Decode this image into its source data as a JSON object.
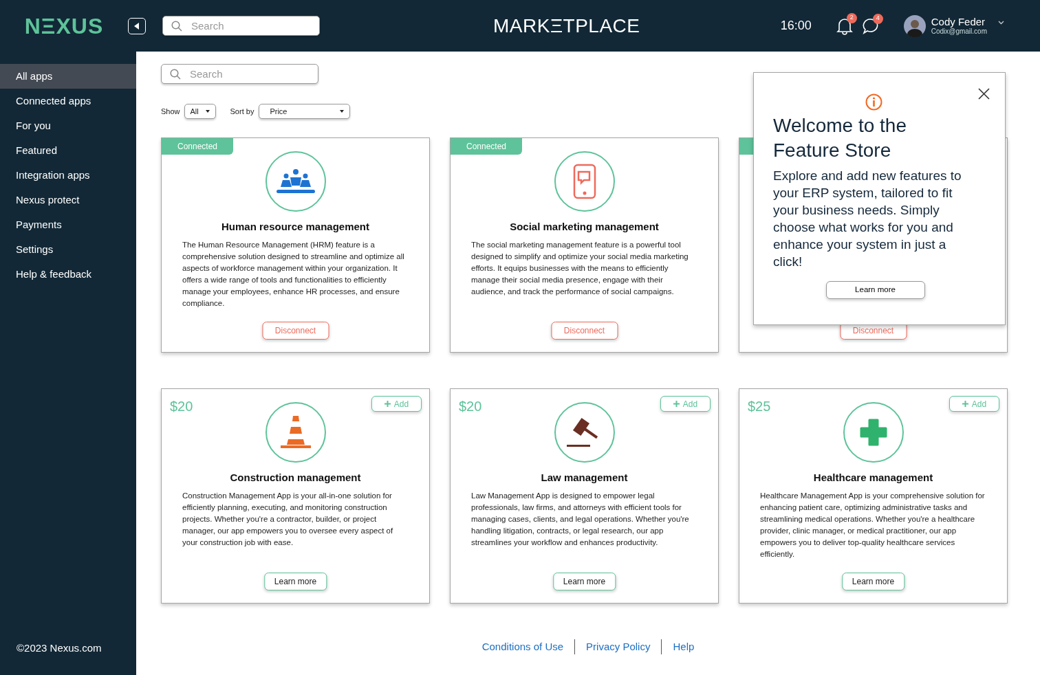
{
  "header": {
    "logo": "NΞXUS",
    "search": {
      "placeholder": "Search"
    },
    "title": "MARKΞTPLACE",
    "time": "16:00",
    "notifications": "2",
    "messages": "4",
    "user": {
      "name": "Cody Feder",
      "email": "Codix@gmail.com"
    }
  },
  "sidebar": {
    "items": [
      {
        "label": "All apps",
        "selected": true
      },
      {
        "label": "Connected apps",
        "selected": false
      },
      {
        "label": "For you",
        "selected": false
      },
      {
        "label": "Featured",
        "selected": false
      },
      {
        "label": "Integration apps",
        "selected": false
      },
      {
        "label": "Nexus protect",
        "selected": false
      },
      {
        "label": "Payments",
        "selected": false
      },
      {
        "label": "Settings",
        "selected": false
      },
      {
        "label": "Help & feedback",
        "selected": false
      }
    ],
    "copyright": "©2023 Nexus.com"
  },
  "filters": {
    "search": {
      "placeholder": "Search"
    },
    "show_label": "Show",
    "show_value": "All",
    "sort_label": "Sort by",
    "sort_value": "Price"
  },
  "cards": [
    {
      "kind": "connected",
      "tag": "Connected",
      "title": "Human resource management",
      "description": "The Human Resource Management (HRM) feature is a comprehensive solution designed to streamline and optimize all aspects of workforce management within your organization. It offers a wide range of tools and functionalities to efficiently manage your employees, enhance HR processes, and ensure compliance.",
      "button": "Disconnect"
    },
    {
      "kind": "connected",
      "tag": "Connected",
      "title": "Social marketing management",
      "description": "The social marketing management feature is a powerful tool designed to simplify and optimize your social media marketing efforts. It equips businesses with the means to efficiently manage their social media presence, engage with their audience, and track the performance of social campaigns.",
      "button": "Disconnect"
    },
    {
      "kind": "connected",
      "button": "Disconnect"
    },
    {
      "kind": "paid",
      "price": "$20",
      "add": "Add",
      "title": "Construction management",
      "description": "Construction Management App is your all-in-one solution for efficiently planning, executing, and monitoring construction projects. Whether you're a contractor, builder, or project manager, our app empowers you to oversee every aspect of your construction job with ease.",
      "button": "Learn more"
    },
    {
      "kind": "paid",
      "price": "$20",
      "add": "Add",
      "title": "Law management",
      "description": "Law Management App is designed to empower legal professionals, law firms, and attorneys with efficient tools for managing cases, clients, and legal operations. Whether you're handling litigation, contracts, or legal research, our app streamlines your workflow and enhances productivity.",
      "button": "Learn more"
    },
    {
      "kind": "paid",
      "price": "$25",
      "add": "Add",
      "title": "Healthcare management",
      "description": "Healthcare Management App is your comprehensive solution for enhancing patient care, optimizing administrative tasks and streamlining medical operations. Whether you're a healthcare provider, clinic manager, or medical practitioner, our app empowers you to deliver top-quality healthcare services efficiently.",
      "button": "Learn more"
    }
  ],
  "popup": {
    "title": "Welcome to the Feature Store",
    "body": "Explore and add new features to your ERP system, tailored to fit your business needs. Simply choose what works for you and enhance your system in just a click!",
    "button": "Learn more"
  },
  "footer": {
    "links": [
      "Conditions of Use",
      "Privacy Policy",
      "Help"
    ]
  }
}
